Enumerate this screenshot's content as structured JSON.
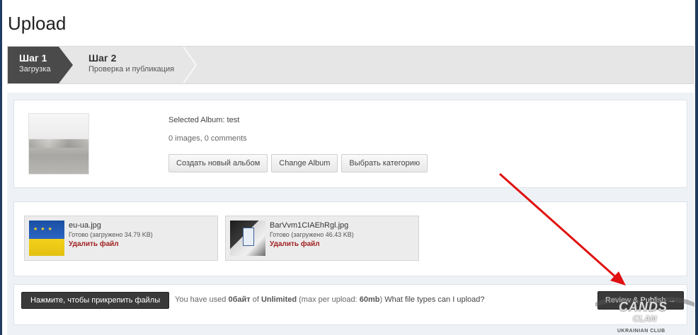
{
  "page": {
    "title": "Upload"
  },
  "steps": [
    {
      "number": "Шаг 1",
      "label": "Загрузка",
      "active": true
    },
    {
      "number": "Шаг 2",
      "label": "Проверка и публикация",
      "active": false
    }
  ],
  "album": {
    "selected": "Selected Album: test",
    "stats": "0 images, 0 comments",
    "buttons": {
      "create": "Создать новый альбом",
      "change": "Change Album",
      "category": "Выбрать категорию"
    }
  },
  "files": [
    {
      "name": "eu-ua.jpg",
      "status": "Готово (загружено 34.79 KB)",
      "delete": "Удалить файл",
      "icon": "eu-ukraine-flag-thumbnail"
    },
    {
      "name": "BarVvm1CIAEhRgl.jpg",
      "status": "Готово (загружено 46.43 KB)",
      "delete": "Удалить файл",
      "icon": "photo-thumbnail"
    }
  ],
  "upload_bar": {
    "attach_label": "Нажмите, чтобы прикрепить файлы",
    "quota_prefix": "You have used",
    "used": "0байт",
    "of": "of",
    "limit": "Unlimited",
    "max_prefix": "(max per upload:",
    "max_value": "60mb",
    "max_suffix": ")",
    "filetypes_link": "What file types can I upload?",
    "review_label": "Review & Publish →"
  },
  "watermark": {
    "main": "CANDS",
    "sub": "CLAN",
    "club": "UKRAINIAN CLUB"
  },
  "colors": {
    "accent_dark": "#3a3a3a",
    "delete_red": "#a02020",
    "annotation_arrow": "#e01010",
    "frame_blue": "#1f3b5e"
  }
}
